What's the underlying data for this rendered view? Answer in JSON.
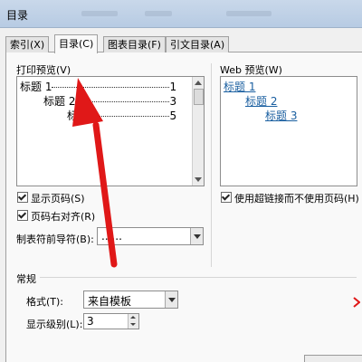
{
  "window": {
    "title": "目录"
  },
  "tabs": [
    {
      "label": "索引(X)"
    },
    {
      "label": "目录(C)"
    },
    {
      "label": "图表目录(F)"
    },
    {
      "label": "引文目录(A)"
    }
  ],
  "print_preview": {
    "label": "打印预览(V)",
    "entries": [
      {
        "text": "标题 1",
        "page": "1"
      },
      {
        "text": "标题 2",
        "page": "3"
      },
      {
        "text": "标题 3",
        "page": "5"
      }
    ]
  },
  "web_preview": {
    "label": "Web 预览(W)",
    "links": [
      "标题 1",
      "标题 2",
      "标题 3"
    ]
  },
  "options": {
    "show_page_numbers": "显示页码(S)",
    "show_page_numbers_checked": true,
    "right_align": "页码右对齐(R)",
    "right_align_checked": true,
    "use_hyperlinks": "使用超链接而不使用页码(H)",
    "use_hyperlinks_checked": true,
    "tab_leader_label": "制表符前导符(B):",
    "tab_leader_value": "......"
  },
  "general": {
    "section_label": "常规",
    "format_label": "格式(T):",
    "format_value": "来自模板",
    "levels_label": "显示级别(L):",
    "levels_value": "3"
  },
  "colors": {
    "annotation_arrow": "#e01818"
  }
}
